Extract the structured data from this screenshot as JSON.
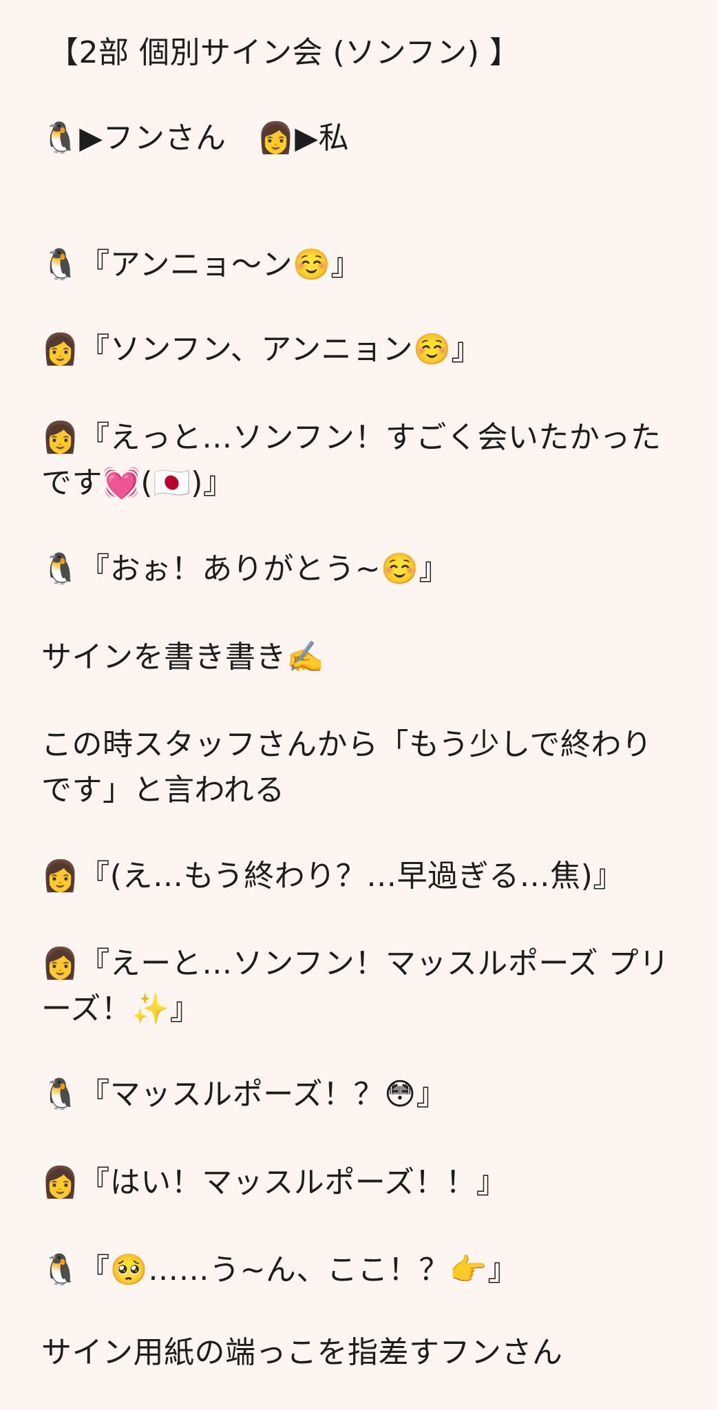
{
  "post": {
    "title": "【2部 個別サイン会 (ソンフン) 】",
    "legend": "🐧▶︎フンさん　👩▶︎私",
    "lines": [
      "🐧『アンニョ〜ン☺️』",
      "👩『ソンフン、アンニョン☺️』",
      "👩『えっと…ソンフン！すごく会いたかったです💓(🇯🇵)』",
      "🐧『おぉ！ありがとう~☺️』",
      "サインを書き書き✍️",
      "この時スタッフさんから「もう少しで終わりです」と言われる",
      "👩『(え…もう終わり？…早過ぎる…焦)』",
      "👩『えーと…ソンフン！マッスルポーズ プリーズ！✨』",
      "🐧『マッスルポーズ！？😳』",
      "👩『はい！マッスルポーズ！！』",
      "🐧『🥺……う~ん、ここ！？👉』",
      "サイン用紙の端っこを指差すフンさん"
    ]
  }
}
